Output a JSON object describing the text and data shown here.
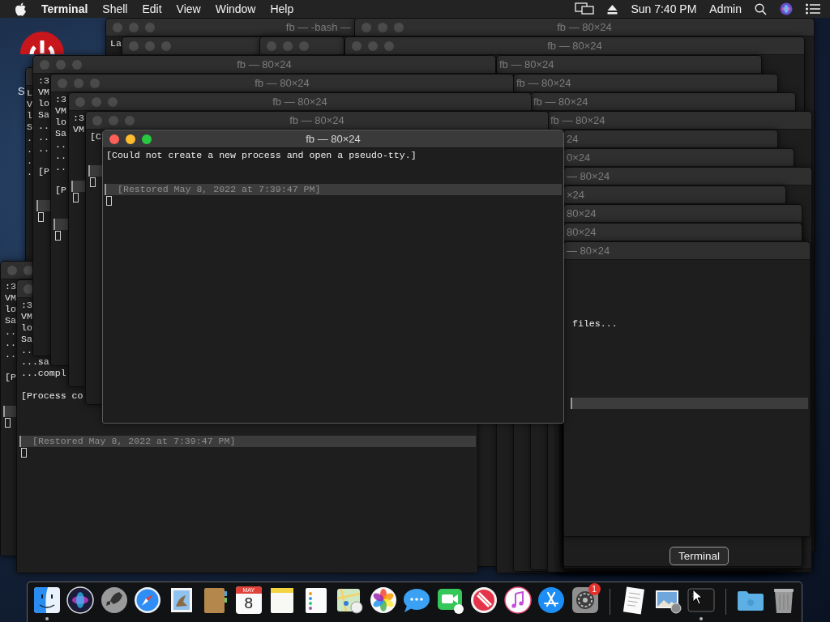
{
  "menubar": {
    "app": "Terminal",
    "menus": [
      "Shell",
      "Edit",
      "View",
      "Window",
      "Help"
    ],
    "clock": "Sun 7:40 PM",
    "user": "Admin"
  },
  "desktop_icons": [
    {
      "label": "S"
    }
  ],
  "windows": [
    {
      "title": "fb — -bash —",
      "active": false,
      "lines": [
        {
          "kind": "text",
          "text": "La"
        }
      ]
    },
    {
      "title": "fb — 80×24",
      "active": false
    },
    {
      "active": false
    },
    {
      "active": false
    },
    {
      "title": "fb — 80×24",
      "active": false
    },
    {
      "lines": [
        {
          "kind": "text",
          "text": "L"
        },
        {
          "kind": "text",
          "text": "V"
        },
        {
          "kind": "text",
          "text": "l"
        },
        {
          "kind": "text",
          "text": "S"
        },
        {
          "kind": "text",
          "text": "."
        },
        {
          "kind": "text",
          "text": "."
        },
        {
          "kind": "text",
          "text": "."
        },
        {
          "kind": "text",
          "text": "."
        }
      ]
    },
    {
      "active": false,
      "lines": [
        {
          "kind": "text",
          "text": ":3"
        },
        {
          "kind": "text",
          "text": "VM"
        },
        {
          "kind": "text",
          "text": "lo"
        },
        {
          "kind": "text",
          "text": "Sa"
        },
        {
          "kind": "text",
          "text": ".."
        },
        {
          "kind": "text",
          "text": ".."
        },
        {
          "kind": "text",
          "text": ".."
        },
        {
          "kind": "blank"
        },
        {
          "kind": "text",
          "text": "[P"
        }
      ],
      "restored_bar": true,
      "cursor": true
    },
    {
      "active": false,
      "lines": [
        {
          "kind": "text",
          "text": ":3"
        },
        {
          "kind": "text",
          "text": "VM"
        },
        {
          "kind": "text",
          "text": "lo"
        },
        {
          "kind": "text",
          "text": "Sa"
        },
        {
          "kind": "text",
          "text": ".."
        },
        {
          "kind": "text",
          "text": "...sa"
        },
        {
          "kind": "text",
          "text": "...compl"
        },
        {
          "kind": "blank"
        },
        {
          "kind": "text",
          "text": "[Process co"
        },
        {
          "kind": "blank"
        }
      ],
      "restored_bar": true,
      "restored_text": "[Restored May 8, 2022 at 7:39:47 PM]",
      "cursor": true
    },
    {
      "title": "fb — 80×24"
    },
    {
      "title": "fb — 80×24"
    },
    {
      "title": "fb — 80×24"
    },
    {
      "title": "fb — 80×24"
    },
    {
      "title": "24"
    },
    {
      "title": "0×24"
    },
    {
      "title": "— 80×24"
    },
    {
      "title": "×24"
    },
    {
      "title": "80×24"
    },
    {
      "title": "80×24"
    },
    {
      "title": "— 80×24",
      "lines": [
        {
          "kind": "blank"
        },
        {
          "kind": "blank"
        },
        {
          "kind": "blank"
        },
        {
          "kind": "blank"
        },
        {
          "kind": "blank"
        },
        {
          "kind": "text",
          "text": "files..."
        },
        {
          "kind": "blank"
        },
        {
          "kind": "blank"
        },
        {
          "kind": "blank"
        },
        {
          "kind": "blank"
        }
      ],
      "restored_bar": true
    },
    {
      "title": "fb — 80×24",
      "active": false,
      "lines": [
        {
          "kind": "text",
          "text": ":3"
        },
        {
          "kind": "text",
          "text": "VM"
        },
        {
          "kind": "text",
          "text": "lo"
        },
        {
          "kind": "text",
          "text": "Sa"
        },
        {
          "kind": "text",
          "text": ".."
        },
        {
          "kind": "text",
          "text": ".."
        },
        {
          "kind": "text",
          "text": ".."
        },
        {
          "kind": "blank"
        },
        {
          "kind": "text",
          "text": "[P"
        }
      ],
      "restored_bar": true,
      "cursor": true
    },
    {
      "title": "fb — 80×24",
      "active": false,
      "lines": [
        {
          "kind": "text",
          "text": ":3"
        },
        {
          "kind": "text",
          "text": "VM"
        },
        {
          "kind": "text",
          "text": "lo"
        },
        {
          "kind": "text",
          "text": "Sa"
        },
        {
          "kind": "text",
          "text": ".."
        },
        {
          "kind": "text",
          "text": ".."
        },
        {
          "kind": "text",
          "text": ".."
        },
        {
          "kind": "blank"
        },
        {
          "kind": "text",
          "text": "[P"
        }
      ],
      "restored_bar": true,
      "cursor": true
    },
    {
      "title": "fb — 80×24",
      "active": false,
      "lines": [
        {
          "kind": "text",
          "text": ":3"
        },
        {
          "kind": "text",
          "text": "VM"
        },
        {
          "kind": "blank"
        },
        {
          "kind": "blank"
        }
      ],
      "restored_bar": true,
      "cursor": true
    },
    {
      "title": "fb — 80×24",
      "active": false,
      "lines": [
        {
          "kind": "text",
          "text": "[C"
        }
      ],
      "restored_bar": true,
      "cursor": true
    },
    {
      "title": "fb — 80×24",
      "active": true,
      "lines": [
        {
          "kind": "text",
          "text": "[Could not create a new process and open a pseudo-tty.]"
        }
      ],
      "restored_bar": true,
      "restored_text": "[Restored May 8, 2022 at 7:39:47 PM]",
      "cursor": true
    }
  ],
  "dock": {
    "tooltip": "Terminal",
    "items": [
      {
        "kind": "finder",
        "running": true
      },
      {
        "kind": "siri"
      },
      {
        "kind": "launchpad"
      },
      {
        "kind": "safari"
      },
      {
        "kind": "mail"
      },
      {
        "kind": "contacts"
      },
      {
        "kind": "calendar",
        "month": "MAY",
        "day": "8"
      },
      {
        "kind": "notes"
      },
      {
        "kind": "reminders"
      },
      {
        "kind": "maps"
      },
      {
        "kind": "photos"
      },
      {
        "kind": "messages"
      },
      {
        "kind": "facetime"
      },
      {
        "kind": "news"
      },
      {
        "kind": "music"
      },
      {
        "kind": "appstore"
      },
      {
        "kind": "preferences",
        "badge": "1"
      },
      {
        "kind": "separator"
      },
      {
        "kind": "textedit"
      },
      {
        "kind": "preview"
      },
      {
        "kind": "terminal",
        "running": true
      },
      {
        "kind": "separator"
      },
      {
        "kind": "folder"
      },
      {
        "kind": "trash"
      }
    ]
  }
}
